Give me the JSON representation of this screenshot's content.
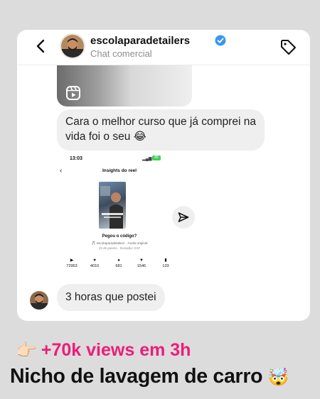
{
  "header": {
    "username": "escolaparadetailers",
    "subtitle": "Chat comercial"
  },
  "messages": {
    "first_text": "Cara o melhor curso que já comprei na vida foi o seu 😂",
    "last_text": "3 horas que postei"
  },
  "screenshot": {
    "time": "13:03",
    "status": "▂▄▆ ≋",
    "battery": "89",
    "title": "Insights do reel",
    "question": "Pegou o código?",
    "meta": "🎵 escolaparadetailers · Áudio original",
    "meta2": "23 de janeiro · Duração: 0:57",
    "stats": [
      {
        "icon": "play-icon",
        "glyph": "▶",
        "value": "72953"
      },
      {
        "icon": "heart-icon",
        "glyph": "♥",
        "value": "4010"
      },
      {
        "icon": "comment-icon",
        "glyph": "●",
        "value": "681"
      },
      {
        "icon": "share-icon",
        "glyph": "▼",
        "value": "1546"
      },
      {
        "icon": "save-icon",
        "glyph": "▮",
        "value": "133"
      }
    ]
  },
  "captions": {
    "line1_emoji": "👉🏻",
    "line1_text": "+70k views em 3h",
    "line2_text": "Nicho de lavagem de carro",
    "line2_emoji": "🤯"
  },
  "colors": {
    "background": "#dcdcdc",
    "verified": "#3897f0",
    "caption_pink": "#ec1d7a",
    "bubble": "#efefef"
  }
}
